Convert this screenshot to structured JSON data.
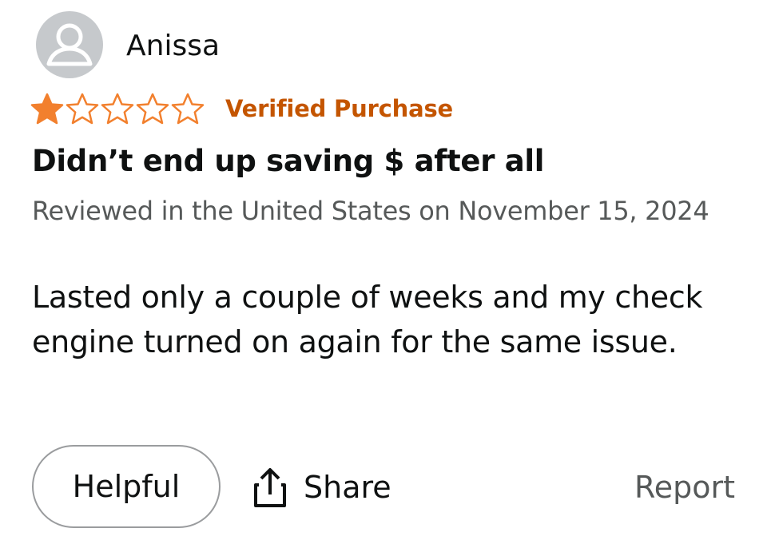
{
  "review": {
    "author": "Anissa",
    "rating": 1,
    "max_rating": 5,
    "verified_label": "Verified Purchase",
    "title": "Didn’t end up saving $ after all",
    "meta": "Reviewed in the United States on November 15, 2024",
    "body": "Lasted only a couple of weeks and my check engine turned on again for the same issue."
  },
  "actions": {
    "helpful_label": "Helpful",
    "share_label": "Share",
    "report_label": "Report"
  },
  "icons": {
    "avatar": "user-avatar-icon",
    "star_filled": "star-filled-icon",
    "star_empty": "star-empty-icon",
    "share": "share-icon"
  },
  "colors": {
    "star": "#f2802e",
    "verified": "#c45500",
    "secondary_text": "#565959",
    "avatar_bg": "#c6c9cc"
  }
}
